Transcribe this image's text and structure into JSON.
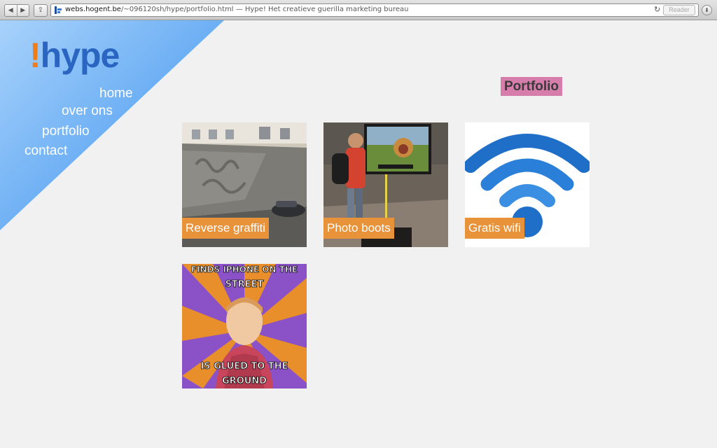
{
  "browser": {
    "back": "◀",
    "forward": "▶",
    "share": "⇪",
    "url_host": "webs.hogent.be",
    "url_path": "/~096120sh/hype/portfolio.html",
    "url_title": " — Hype! Het creatieve guerilla marketing bureau",
    "reload": "↻",
    "reader": "Reader",
    "download": "⬇"
  },
  "logo": {
    "mark": "!",
    "text": "hype"
  },
  "nav": [
    {
      "label": "home"
    },
    {
      "label": "over ons"
    },
    {
      "label": "portfolio"
    },
    {
      "label": "contact"
    }
  ],
  "page": {
    "title": "Portfolio"
  },
  "portfolio": [
    {
      "caption": "Reverse graffiti"
    },
    {
      "caption": "Photo boots"
    },
    {
      "caption": "Gratis wifi"
    },
    {
      "caption": ""
    }
  ],
  "meme": {
    "top": "FINDS IPHONE ON THE STREET",
    "bottom": "IS GLUED TO THE GROUND"
  },
  "colors": {
    "accent_orange": "#e8923a",
    "title_bg": "#d67dab",
    "logo_blue": "#2a66c1",
    "logo_orange": "#ef7d1a"
  }
}
